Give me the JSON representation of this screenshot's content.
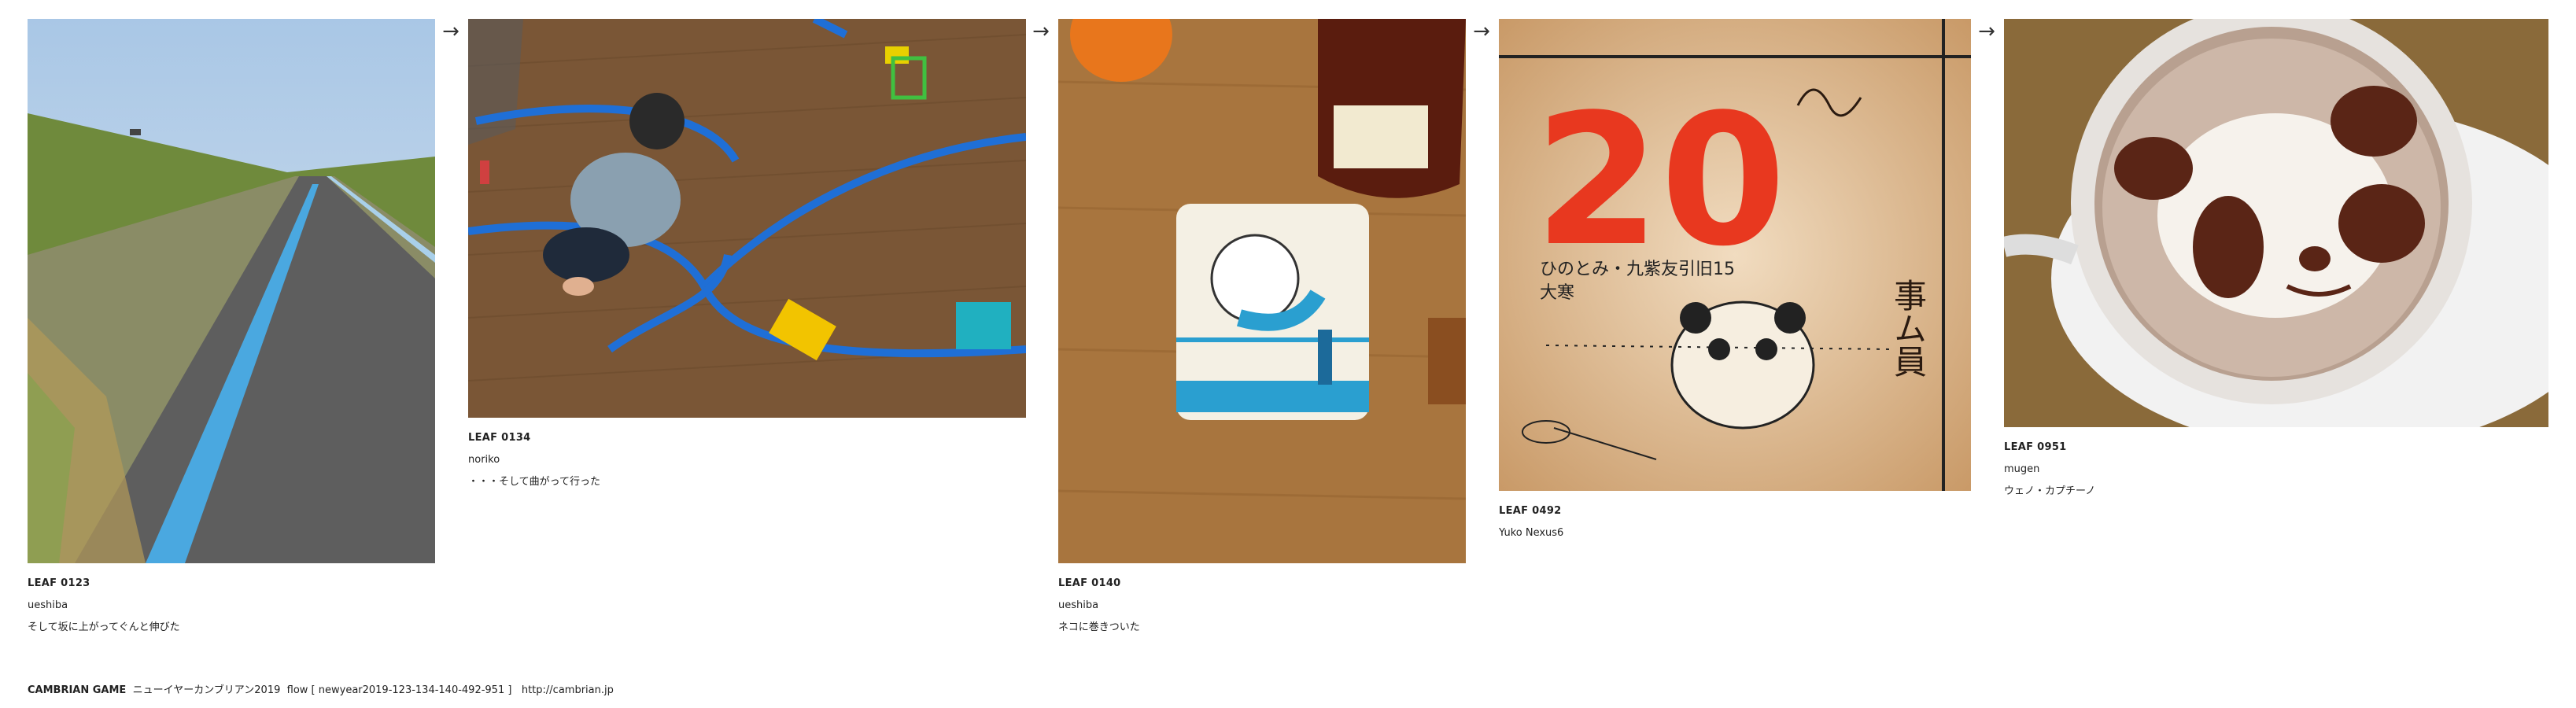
{
  "leaves": [
    {
      "id": "LEAF 0123",
      "author": "ueshiba",
      "caption": "そして坂に上がってぐんと伸びた"
    },
    {
      "id": "LEAF 0134",
      "author": "noriko",
      "caption": "・・・そして曲がって行った"
    },
    {
      "id": "LEAF 0140",
      "author": "ueshiba",
      "caption": "ネコに巻きついた"
    },
    {
      "id": "LEAF 0492",
      "author": "Yuko Nexus6",
      "caption": ""
    },
    {
      "id": "LEAF 0951",
      "author": "mugen",
      "caption": "ウェノ・カプチーノ"
    }
  ],
  "arrow_glyph": "→",
  "calendar": {
    "day": "20",
    "line1": "ひのとみ・九紫友引旧15",
    "line2": "大寒",
    "handwriting": "事ム員"
  },
  "footer": {
    "brand": "CAMBRIAN GAME",
    "title": "ニューイヤーカンブリアン2019",
    "flow": "flow [ newyear2019-123-134-140-492-951 ]",
    "url": "http://cambrian.jp"
  },
  "colors": {
    "path_blue": "#4aa8e0",
    "track_blue": "#1f6fd6",
    "calendar_red": "#e8381f"
  }
}
